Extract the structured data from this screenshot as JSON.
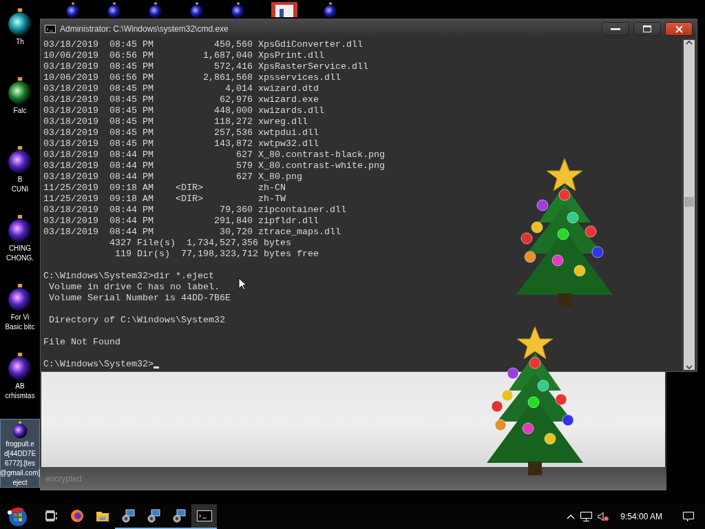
{
  "desktop_icons": [
    {
      "kind": "teal",
      "label_lines": [
        "Th"
      ],
      "selected": false
    },
    {
      "kind": "green",
      "label_lines": [
        "Falc"
      ],
      "selected": false
    },
    {
      "kind": "purple",
      "label_lines": [
        "B",
        "CUNI"
      ],
      "selected": false
    },
    {
      "kind": "purple",
      "label_lines": [
        "CHING",
        "CHONG."
      ],
      "selected": false
    },
    {
      "kind": "purple",
      "label_lines": [
        "For Vi",
        "Basic bitc"
      ],
      "selected": false
    },
    {
      "kind": "purple",
      "label_lines": [
        "AB",
        "crhismtas"
      ],
      "selected": false
    },
    {
      "kind": "purple",
      "label_lines": [
        "frogpult.e",
        "d[44DD7E",
        "6772].[tes",
        "@gmail.com]",
        "eject"
      ],
      "selected": true
    }
  ],
  "top_icons": [
    {
      "kind": "blue"
    },
    {
      "kind": "blue"
    },
    {
      "kind": "blue"
    },
    {
      "kind": "blue"
    },
    {
      "kind": "blue"
    },
    {
      "kind": "picture"
    },
    {
      "kind": "blue"
    }
  ],
  "ransom_window": {
    "footer": "encrypted"
  },
  "cmd_window": {
    "title": "Administrator: C:\\Windows\\system32\\cmd.exe",
    "blocks": [
      [
        "03/18/2019  08:45 PM           450,560 XpsGdiConverter.dll",
        "10/06/2019  06:56 PM         1,687,040 XpsPrint.dll",
        "03/18/2019  08:45 PM           572,416 XpsRasterService.dll",
        "10/06/2019  06:56 PM         2,861,568 xpsservices.dll",
        "03/18/2019  08:45 PM             4,014 xwizard.dtd",
        "03/18/2019  08:45 PM            62,976 xwizard.exe",
        "03/18/2019  08:45 PM           448,000 xwizards.dll",
        "03/18/2019  08:45 PM           118,272 xwreg.dll",
        "03/18/2019  08:45 PM           257,536 xwtpdui.dll",
        "03/18/2019  08:45 PM           143,872 xwtpw32.dll",
        "03/18/2019  08:44 PM               627 X_80.contrast-black.png",
        "03/18/2019  08:44 PM               579 X_80.contrast-white.png",
        "03/18/2019  08:44 PM               627 X_80.png",
        "11/25/2019  09:18 AM    <DIR>          zh-CN",
        "11/25/2019  09:18 AM    <DIR>          zh-TW",
        "03/18/2019  08:44 PM            79,360 zipcontainer.dll",
        "03/18/2019  08:44 PM           291,840 zipfldr.dll",
        "03/18/2019  08:44 PM            30,720 ztrace_maps.dll",
        "            4327 File(s)  1,734,527,356 bytes",
        "             119 Dir(s)  77,198,323,712 bytes free"
      ],
      [
        "C:\\Windows\\System32>dir *.eject",
        " Volume in drive C has no label.",
        " Volume Serial Number is 44DD-7B6E"
      ],
      [
        " Directory of C:\\Windows\\System32"
      ],
      [
        "File Not Found"
      ]
    ],
    "prompt": "C:\\Windows\\System32>"
  },
  "taskbar": {
    "items": [
      {
        "kind": "start",
        "running": false,
        "selected": false
      },
      {
        "kind": "task-view",
        "running": false,
        "selected": false
      },
      {
        "kind": "browser",
        "running": false,
        "selected": false
      },
      {
        "kind": "folder",
        "running": false,
        "selected": false
      },
      {
        "kind": "app",
        "running": true,
        "selected": false
      },
      {
        "kind": "app",
        "running": true,
        "selected": false
      },
      {
        "kind": "app",
        "running": true,
        "selected": false
      },
      {
        "kind": "console",
        "running": true,
        "selected": true
      }
    ],
    "volume_muted": true,
    "clock": "9:54:00 AM"
  }
}
